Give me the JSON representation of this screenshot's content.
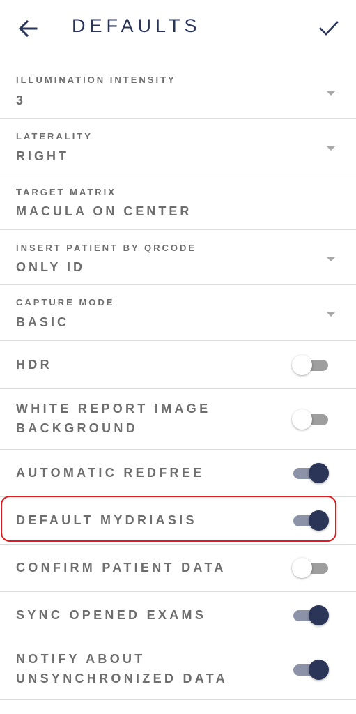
{
  "header": {
    "title": "DEFAULTS",
    "back_icon": "arrow-left-icon",
    "confirm_icon": "checkmark-icon"
  },
  "colors": {
    "primary": "#2a3557",
    "text": "#6e6e6e",
    "divider": "#dcdcdc",
    "highlight": "#e3191c",
    "switch_off_track": "#9e9e9e",
    "switch_on_track": "#8c92a8"
  },
  "dropdowns": [
    {
      "label": "ILLUMINATION INTENSITY",
      "value": "3",
      "has_caret": true
    },
    {
      "label": "LATERALITY",
      "value": "RIGHT",
      "has_caret": true
    },
    {
      "label": "TARGET MATRIX",
      "value": "MACULA ON CENTER",
      "has_caret": false
    },
    {
      "label": "INSERT PATIENT BY QRCODE",
      "value": "ONLY ID",
      "has_caret": true
    },
    {
      "label": "CAPTURE MODE",
      "value": "BASIC",
      "has_caret": true
    }
  ],
  "toggles": [
    {
      "label": "HDR",
      "on": false
    },
    {
      "label": "WHITE REPORT IMAGE\nBACKGROUND",
      "on": false
    },
    {
      "label": "AUTOMATIC REDFREE",
      "on": true
    },
    {
      "label": "DEFAULT MYDRIASIS",
      "on": true,
      "highlighted": true
    },
    {
      "label": "CONFIRM PATIENT DATA",
      "on": false
    },
    {
      "label": "SYNC OPENED EXAMS",
      "on": true
    },
    {
      "label": "NOTIFY ABOUT\nUNSYNCHRONIZED DATA",
      "on": true
    }
  ]
}
